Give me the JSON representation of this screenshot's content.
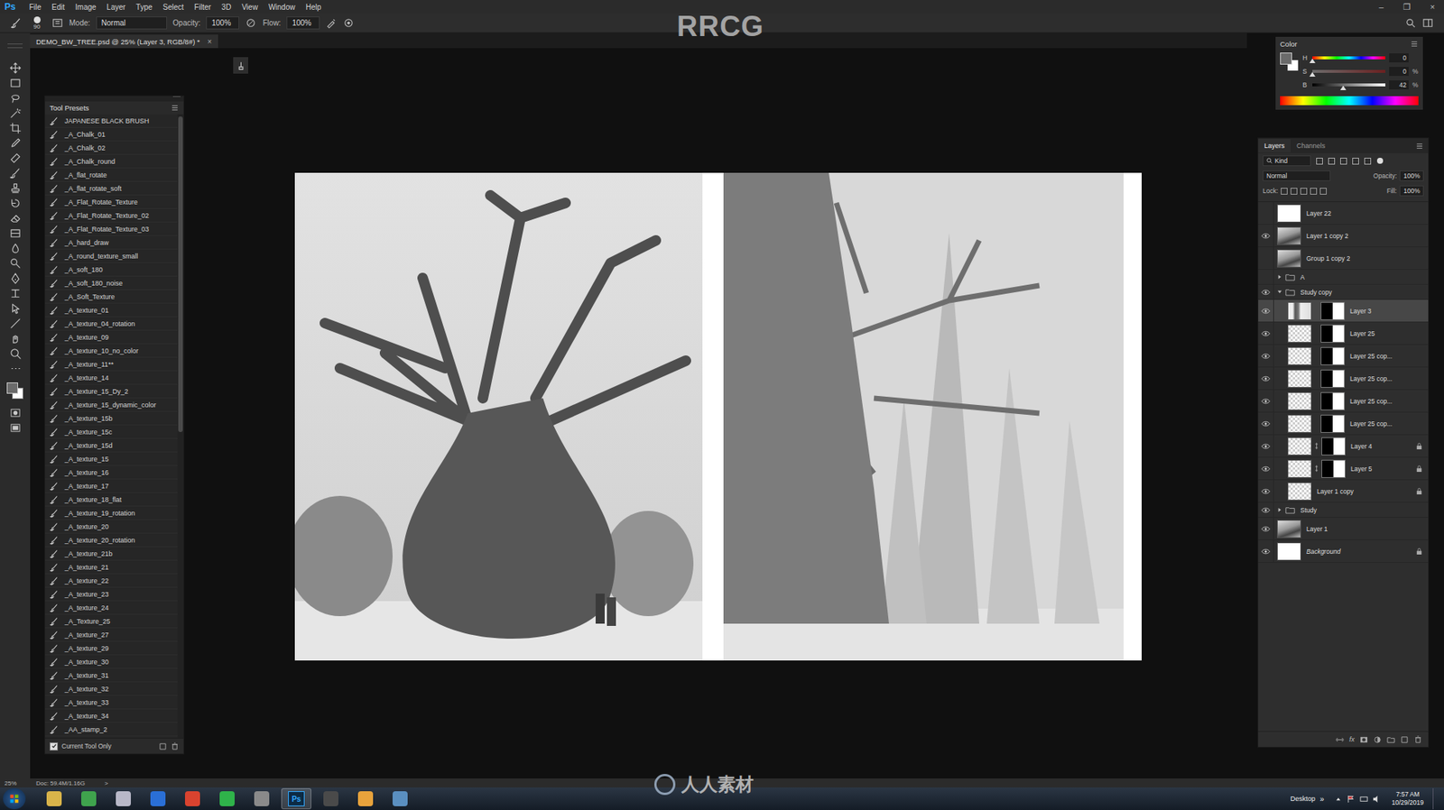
{
  "app": {
    "logo": "Ps",
    "menu": [
      "File",
      "Edit",
      "Image",
      "Layer",
      "Type",
      "Select",
      "Filter",
      "3D",
      "View",
      "Window",
      "Help"
    ],
    "window_controls": [
      "–",
      "❐",
      "×"
    ]
  },
  "options_bar": {
    "brush_size": "90",
    "mode_label": "Mode:",
    "mode": "Normal",
    "opacity_label": "Opacity:",
    "opacity": "100%",
    "flow_label": "Flow:",
    "flow": "100%"
  },
  "document_tab": {
    "title": "DEMO_BW_TREE.psd @ 25% (Layer 3, RGB/8#) *",
    "close": "×"
  },
  "tool_presets": {
    "title": "Tool Presets",
    "items": [
      "JAPANESE BLACK BRUSH",
      "_A_Chalk_01",
      "_A_Chalk_02",
      "_A_Chalk_round",
      "_A_flat_rotate",
      "_A_flat_rotate_soft",
      "_A_Flat_Rotate_Texture",
      "_A_Flat_Rotate_Texture_02",
      "_A_Flat_Rotate_Texture_03",
      "_A_hard_draw",
      "_A_round_texture_small",
      "_A_soft_180",
      "_A_soft_180_noise",
      "_A_Soft_Texture",
      "_A_texture_01",
      "_A_texture_04_rotation",
      "_A_texture_09",
      "_A_texture_10_no_color",
      "_A_texture_11**",
      "_A_texture_14",
      "_A_texture_15_Dy_2",
      "_A_texture_15_dynamic_color",
      "_A_texture_15b",
      "_A_texture_15c",
      "_A_texture_15d",
      "_A_texture_15",
      "_A_texture_16",
      "_A_texture_17",
      "_A_texture_18_flat",
      "_A_texture_19_rotation",
      "_A_texture_20",
      "_A_texture_20_rotation",
      "_A_texture_21b",
      "_A_texture_21",
      "_A_texture_22",
      "_A_texture_23",
      "_A_texture_24",
      "_A_Texture_25",
      "_A_texture_27",
      "_A_texture_29",
      "_A_texture_30",
      "_A_texture_31",
      "_A_texture_32",
      "_A_texture_33",
      "_A_texture_34",
      "_AA_stamp_2"
    ],
    "current_tool_only": {
      "label": "Current Tool Only",
      "checked": true
    }
  },
  "color_panel": {
    "title": "Color",
    "channels": [
      {
        "label": "H",
        "kind": "hue",
        "level": 0.0,
        "value": "0",
        "unit": ""
      },
      {
        "label": "S",
        "kind": "saturation",
        "level": 0.0,
        "value": "0",
        "unit": "%"
      },
      {
        "label": "B",
        "kind": "brightness",
        "level": 0.42,
        "value": "42",
        "unit": "%"
      }
    ]
  },
  "layers_panel": {
    "tabs": [
      {
        "label": "Layers",
        "selected": true
      },
      {
        "label": "Channels",
        "selected": false
      }
    ],
    "filter": "Kind",
    "blend_mode": "Normal",
    "opacity_label": "Opacity:",
    "opacity": "100%",
    "lock_label": "Lock:",
    "fill_label": "Fill:",
    "fill": "100%",
    "footer_fx": "fx",
    "layers": [
      {
        "name": "Layer 22",
        "kind": "layer",
        "visible": false,
        "selected": false,
        "depth": 0,
        "thumb": "white",
        "mask": false,
        "linked": false,
        "locked": false,
        "expanded": false
      },
      {
        "name": "Layer 1 copy 2",
        "kind": "layer",
        "visible": true,
        "selected": false,
        "depth": 0,
        "thumb": "photo",
        "mask": false,
        "linked": false,
        "locked": false,
        "expanded": false
      },
      {
        "name": "Group 1 copy 2",
        "kind": "layer",
        "visible": false,
        "selected": false,
        "depth": 0,
        "thumb": "photo",
        "mask": false,
        "linked": false,
        "locked": false,
        "expanded": false
      },
      {
        "name": "A",
        "kind": "group",
        "visible": false,
        "selected": false,
        "depth": 0,
        "thumb": "none",
        "mask": false,
        "linked": false,
        "locked": false,
        "expanded": false
      },
      {
        "name": "Study copy",
        "kind": "group",
        "visible": true,
        "selected": false,
        "depth": 0,
        "thumb": "none",
        "mask": false,
        "linked": false,
        "locked": false,
        "expanded": true
      },
      {
        "name": "Layer 3",
        "kind": "layer",
        "visible": true,
        "selected": true,
        "depth": 1,
        "thumb": "sketch",
        "mask": true,
        "linked": false,
        "locked": false,
        "expanded": false
      },
      {
        "name": "Layer 25",
        "kind": "layer",
        "visible": true,
        "selected": false,
        "depth": 1,
        "thumb": "checker",
        "mask": true,
        "linked": false,
        "locked": false,
        "expanded": false
      },
      {
        "name": "Layer 25 cop...",
        "kind": "layer",
        "visible": true,
        "selected": false,
        "depth": 1,
        "thumb": "checker",
        "mask": true,
        "linked": false,
        "locked": false,
        "expanded": false
      },
      {
        "name": "Layer 25 cop...",
        "kind": "layer",
        "visible": true,
        "selected": false,
        "depth": 1,
        "thumb": "checker",
        "mask": true,
        "linked": false,
        "locked": false,
        "expanded": false
      },
      {
        "name": "Layer 25 cop...",
        "kind": "layer",
        "visible": true,
        "selected": false,
        "depth": 1,
        "thumb": "checker",
        "mask": true,
        "linked": false,
        "locked": false,
        "expanded": false
      },
      {
        "name": "Layer 25 cop...",
        "kind": "layer",
        "visible": true,
        "selected": false,
        "depth": 1,
        "thumb": "checker",
        "mask": true,
        "linked": false,
        "locked": false,
        "expanded": false
      },
      {
        "name": "Layer 4",
        "kind": "layer",
        "visible": true,
        "selected": false,
        "depth": 1,
        "thumb": "checker",
        "mask": true,
        "linked": true,
        "locked": true,
        "expanded": false
      },
      {
        "name": "Layer 5",
        "kind": "layer",
        "visible": true,
        "selected": false,
        "depth": 1,
        "thumb": "checker",
        "mask": true,
        "linked": true,
        "locked": true,
        "expanded": false
      },
      {
        "name": "Layer 1 copy",
        "kind": "layer",
        "visible": true,
        "selected": false,
        "depth": 1,
        "thumb": "checker",
        "mask": false,
        "linked": false,
        "locked": true,
        "expanded": false
      },
      {
        "name": "Study",
        "kind": "group",
        "visible": true,
        "selected": false,
        "depth": 0,
        "thumb": "none",
        "mask": false,
        "linked": false,
        "locked": false,
        "expanded": false
      },
      {
        "name": "Layer 1",
        "kind": "layer",
        "visible": true,
        "selected": false,
        "depth": 0,
        "thumb": "photo",
        "mask": false,
        "linked": false,
        "locked": false,
        "expanded": false
      },
      {
        "name": "Background",
        "kind": "background",
        "visible": true,
        "selected": false,
        "depth": 0,
        "thumb": "white",
        "mask": false,
        "linked": false,
        "locked": true,
        "expanded": false
      }
    ]
  },
  "status_bar": {
    "zoom": "25%",
    "doc": "Doc: 59.4M/1.16G",
    "arrow": ">"
  },
  "taskbar": {
    "apps": [
      {
        "kind": "icon",
        "label": "",
        "color": "#d9b44a",
        "selected": false
      },
      {
        "kind": "icon",
        "label": "",
        "color": "#3fa34d",
        "selected": false
      },
      {
        "kind": "icon",
        "label": "",
        "color": "#b8b8c8",
        "selected": false
      },
      {
        "kind": "icon",
        "label": "",
        "color": "#2a6fd6",
        "selected": false
      },
      {
        "kind": "icon",
        "label": "",
        "color": "#d9432f",
        "selected": false
      },
      {
        "kind": "icon",
        "label": "",
        "color": "#2fb34a",
        "selected": false
      },
      {
        "kind": "icon",
        "label": "",
        "color": "#8a8a8a",
        "selected": false
      },
      {
        "kind": "text",
        "label": "Ps",
        "color": "#0d2b45",
        "selected": true
      },
      {
        "kind": "icon",
        "label": "",
        "color": "#4a4a4a",
        "selected": false
      },
      {
        "kind": "icon",
        "label": "",
        "color": "#e8a33c",
        "selected": false
      },
      {
        "kind": "icon",
        "label": "",
        "color": "#5a8fc0",
        "selected": false
      }
    ],
    "desktop": "Desktop",
    "overflow": "»",
    "time": "7:57 AM",
    "date": "10/29/2019"
  },
  "watermarks": {
    "top": "RRCG",
    "bottom": "人人素材"
  }
}
